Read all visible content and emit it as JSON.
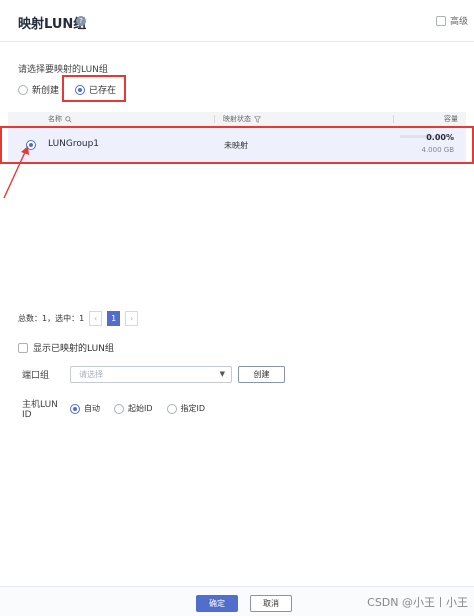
{
  "dialog": {
    "title": "映射LUN组",
    "help_icon_glyph": "?",
    "advanced_label": "高级"
  },
  "select_section": {
    "label": "请选择要映射的LUN组",
    "options": [
      {
        "label": "新创建",
        "selected": false
      },
      {
        "label": "已存在",
        "selected": true
      }
    ]
  },
  "table": {
    "columns": {
      "name": "名称",
      "status": "映射状态",
      "capacity": "容量"
    },
    "rows": [
      {
        "selected": true,
        "name": "LUNGroup1",
        "status": "未映射",
        "capacity_pct": "0.00%",
        "capacity_size": "4.000 GB",
        "usage": 0
      }
    ]
  },
  "pager": {
    "summary": "总数：1，选中：1",
    "prev": "‹",
    "page": "1",
    "next": "›"
  },
  "show_mapped": {
    "label": "显示已映射的LUN组"
  },
  "port_group": {
    "label": "端口组",
    "placeholder": "请选择",
    "caret": "▼",
    "create_label": "创建"
  },
  "lun_id": {
    "label": "主机LUN ID",
    "options": [
      {
        "label": "自动",
        "selected": true
      },
      {
        "label": "起始ID",
        "selected": false
      },
      {
        "label": "指定ID",
        "selected": false
      }
    ]
  },
  "footer": {
    "ok_label": "确定",
    "cancel_label": "取消",
    "watermark": "CSDN @小王丨小王"
  },
  "colors": {
    "accent": "#526ecc",
    "highlight": "#e53935",
    "row_selected": "#eef1fb"
  }
}
